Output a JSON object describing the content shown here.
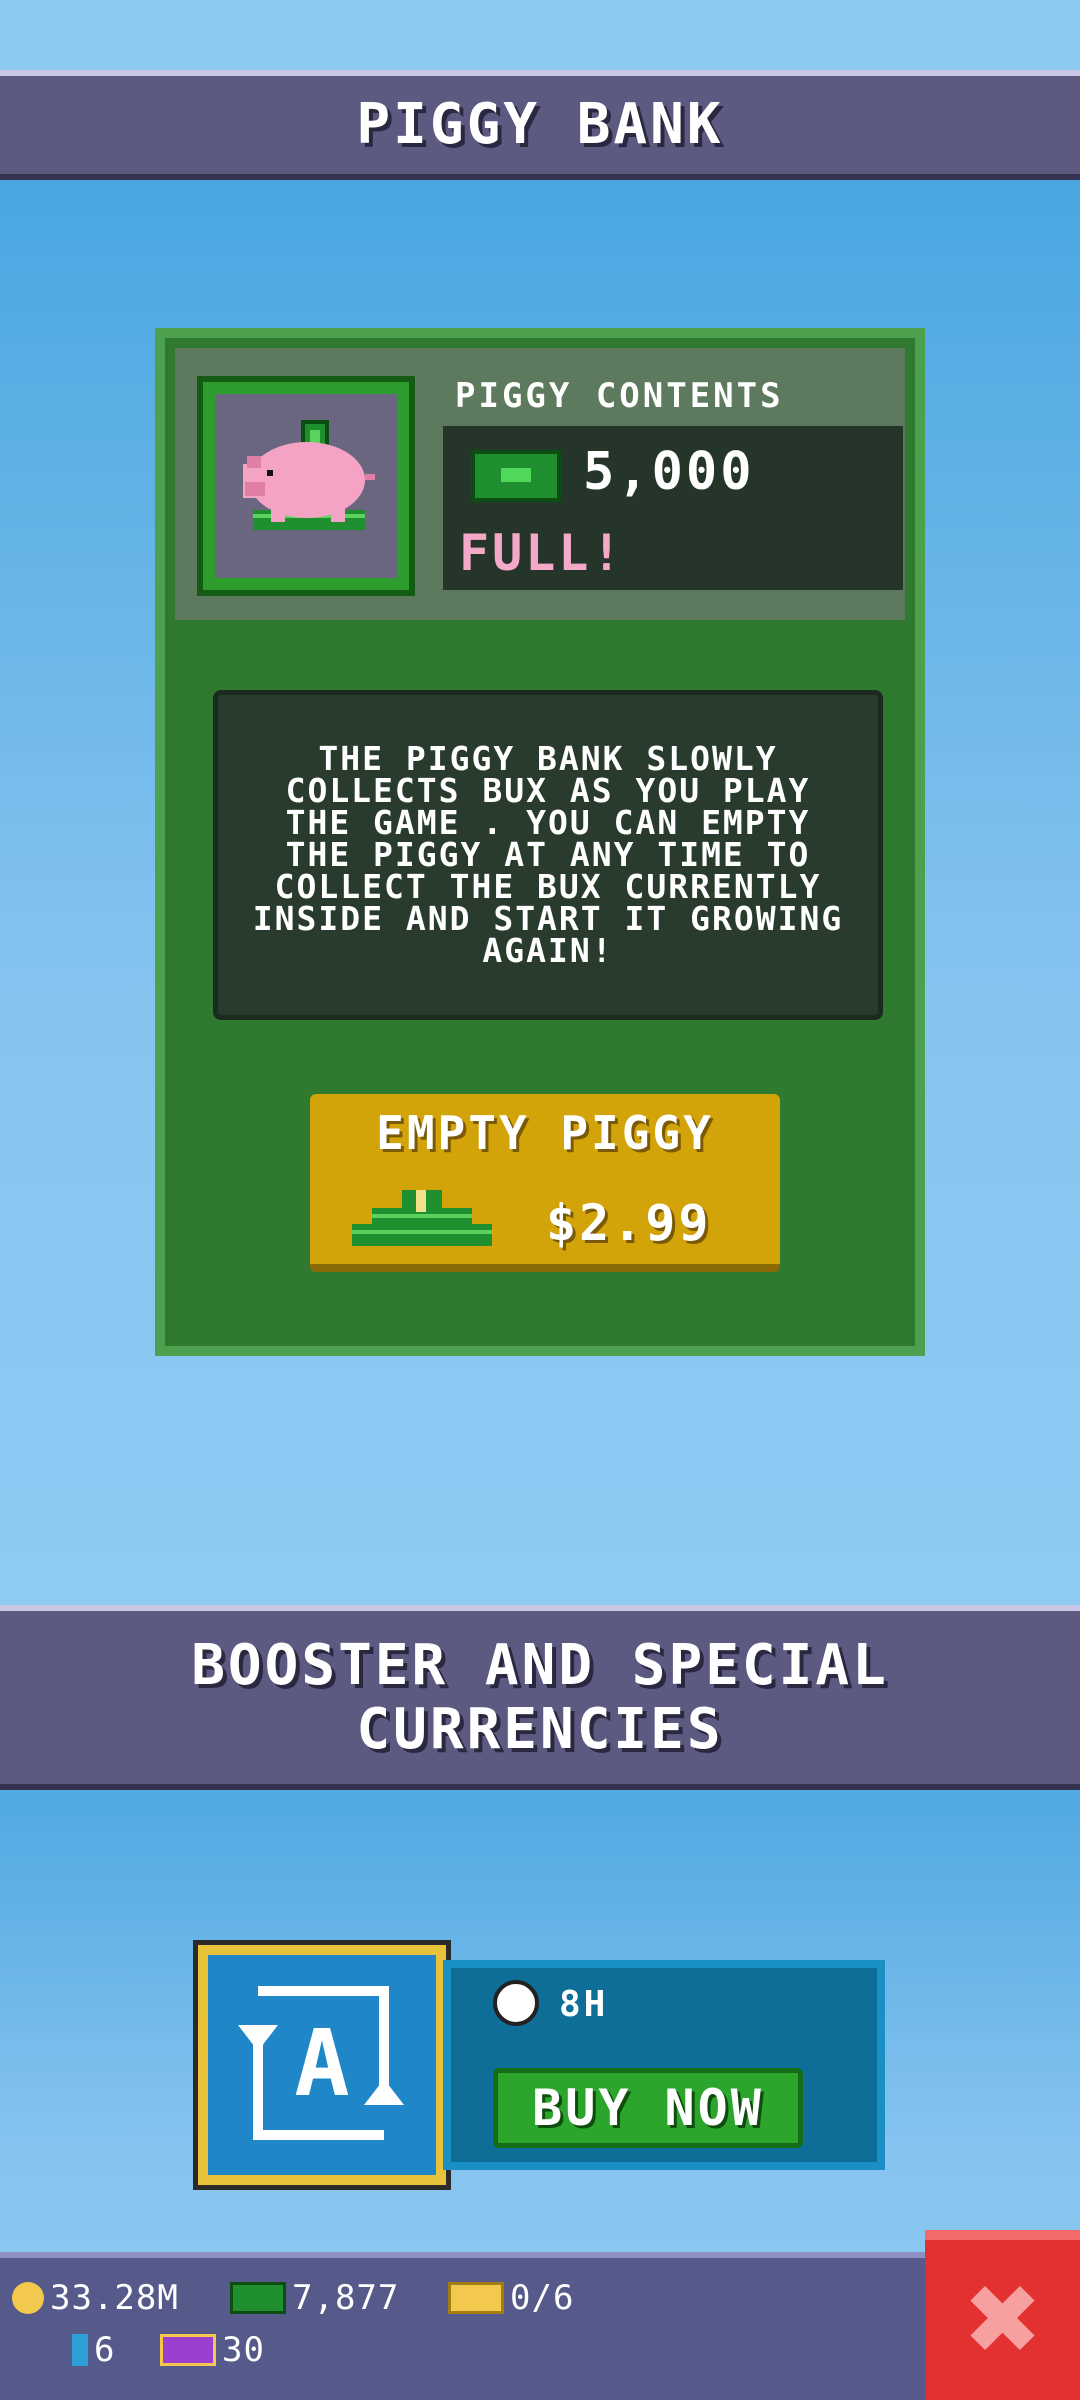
{
  "piggy_section": {
    "title": "PIGGY BANK",
    "contents_header": "PIGGY CONTENTS",
    "amount": "5,000",
    "status": "FULL!",
    "description": "THE PIGGY BANK SLOWLY COLLECTS BUX AS YOU PLAY THE GAME . YOU CAN EMPTY THE PIGGY AT ANY TIME TO COLLECT THE BUX CURRENTLY INSIDE AND START IT GROWING AGAIN!",
    "empty_button_label": "EMPTY PIGGY",
    "empty_button_price": "$2.99"
  },
  "booster_section": {
    "title": "BOOSTER AND SPECIAL CURRENCIES",
    "timer": "8H",
    "buy_label": "BUY NOW"
  },
  "bottom_bar": {
    "coins": "33.28M",
    "bux": "7,877",
    "tickets": "0/6",
    "gems": "6",
    "vip": "30"
  },
  "colors": {
    "banner": "#5d5a82",
    "card_green": "#2f7a2f",
    "button_gold": "#d3a30a",
    "buy_green": "#2ba52b",
    "close_red": "#e33131"
  },
  "icons": [
    "pig-icon",
    "bux-icon",
    "cash-stack-icon",
    "auto-refresh-icon",
    "timer-icon",
    "coin-icon",
    "ticket-icon",
    "gem-icon",
    "vip-icon",
    "close-icon"
  ]
}
